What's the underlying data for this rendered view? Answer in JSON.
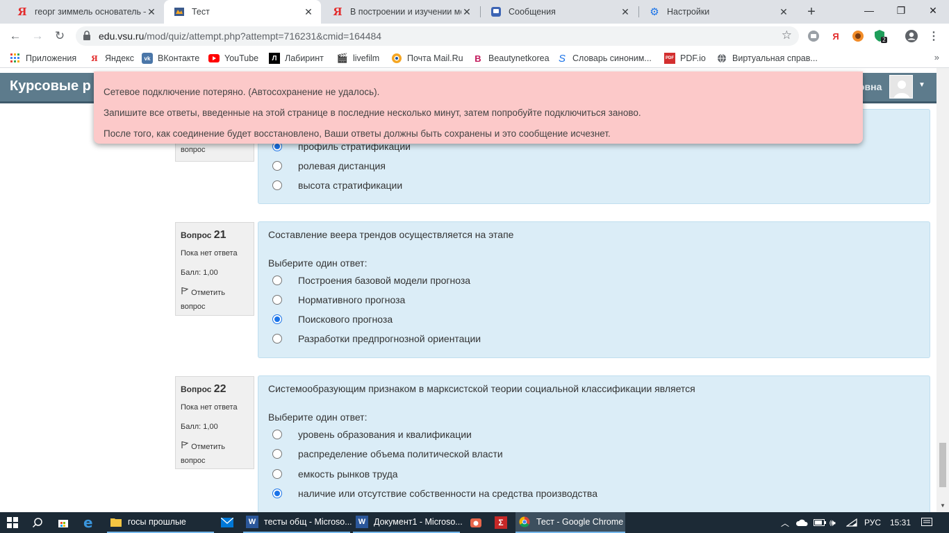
{
  "browser": {
    "tabs": [
      {
        "title": "георг зиммель основатель —",
        "icon": "yandex-icon"
      },
      {
        "title": "Тест",
        "icon": "moodle-icon"
      },
      {
        "title": "В построении и изучении мо",
        "icon": "yandex-icon"
      },
      {
        "title": "Сообщения",
        "icon": "messages-icon"
      },
      {
        "title": "Настройки",
        "icon": "settings-gear-icon"
      }
    ],
    "url_host": "edu.vsu.ru",
    "url_path": "/mod/quiz/attempt.php?attempt=716231&cmid=164484",
    "extension_badge": "2",
    "bookmarks": [
      {
        "label": "Приложения",
        "icon": "apps-grid-icon"
      },
      {
        "label": "Яндекс",
        "icon": "yandex-icon"
      },
      {
        "label": "ВКонтакте",
        "icon": "vk-icon"
      },
      {
        "label": "YouTube",
        "icon": "youtube-icon"
      },
      {
        "label": "Лабиринт",
        "icon": "labirint-icon"
      },
      {
        "label": "livefilm",
        "icon": "film-icon"
      },
      {
        "label": "Почта Mail.Ru",
        "icon": "mail-ru-icon"
      },
      {
        "label": "Beautynetkorea",
        "icon": "beauty-icon"
      },
      {
        "label": "Словарь синоним...",
        "icon": "dictionary-icon"
      },
      {
        "label": "PDF.io",
        "icon": "pdf-icon"
      },
      {
        "label": "Виртуальная справ...",
        "icon": "globe-icon"
      }
    ],
    "bookmarks_more": "»"
  },
  "site": {
    "name": "Курсовые р",
    "user_suffix": "овна"
  },
  "alert": {
    "line1": "Сетевое подключение потеряно. (Автосохранение не удалось).",
    "line2": "Запишите все ответы, введенные на этой странице в последние несколько минут, затем попробуйте подключиться заново.",
    "line3": "После того, как соединение будет восстановлено, Ваши ответы должны быть сохранены и это сообщение исчезнет."
  },
  "question20": {
    "info_tail": "вопрос",
    "answers": [
      {
        "label": "профиль стратификации",
        "checked": true
      },
      {
        "label": "ролевая дистанция",
        "checked": false
      },
      {
        "label": "высота стратификации",
        "checked": false
      }
    ]
  },
  "question21": {
    "label": "Вопрос",
    "number": "21",
    "state": "Пока нет ответа",
    "grade": "Балл: 1,00",
    "flag": "Отметить",
    "flag2": "вопрос",
    "text": "Составление веера трендов осуществляется на этапе",
    "prompt": "Выберите один ответ:",
    "answers": [
      {
        "label": "Построения базовой модели прогноза",
        "checked": false
      },
      {
        "label": "Нормативного прогноза",
        "checked": false
      },
      {
        "label": "Поискового прогноза",
        "checked": true
      },
      {
        "label": "Разработки предпрогнозной ориентации",
        "checked": false
      }
    ]
  },
  "question22": {
    "label": "Вопрос",
    "number": "22",
    "state": "Пока нет ответа",
    "grade": "Балл: 1,00",
    "flag": "Отметить",
    "flag2": "вопрос",
    "text": "Системообразующим признаком в марксистской теории социальной классификации является",
    "prompt": "Выберите один ответ:",
    "answers": [
      {
        "label": "уровень образования и квалификации",
        "checked": false
      },
      {
        "label": "распределение объема политической власти",
        "checked": false
      },
      {
        "label": "емкость рынков труда",
        "checked": false
      },
      {
        "label": "наличие или отсутствие собственности на средства производства",
        "checked": true
      }
    ]
  },
  "taskbar": {
    "apps": [
      {
        "label": "госы прошлые",
        "icon": "folder-icon"
      },
      {
        "label": "тесты общ - Microso...",
        "icon": "word-icon"
      },
      {
        "label": "Документ1 - Microso...",
        "icon": "word-icon"
      },
      {
        "label": "Тест - Google Chrome",
        "icon": "chrome-icon"
      }
    ],
    "lang": "РУС",
    "time": "15:31"
  },
  "colors": {
    "navbar": "#5d7b8c",
    "question_bg": "#dbedf7",
    "alert_bg": "#fcc9c9",
    "radio_checked": "#1a73e8",
    "taskbar": "#1c2a36"
  }
}
